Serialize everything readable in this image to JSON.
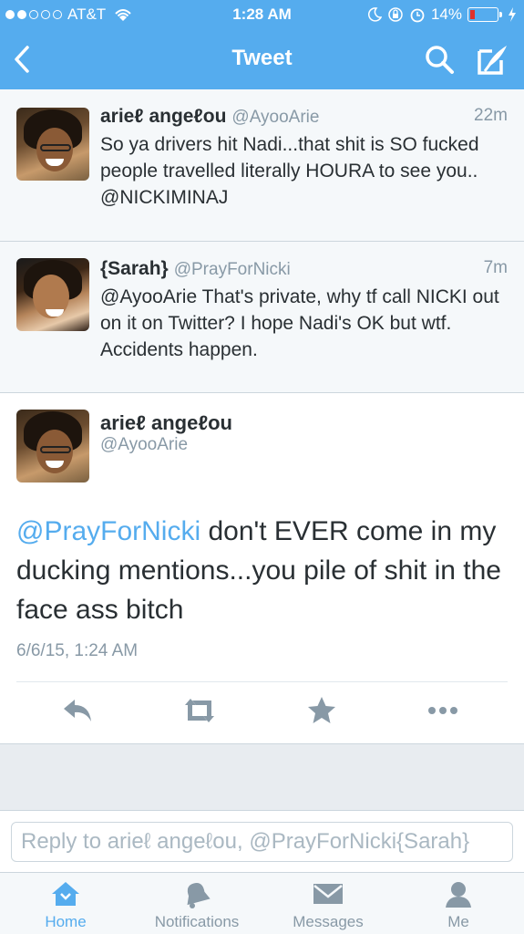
{
  "status_bar": {
    "carrier": "AT&T",
    "time": "1:28 AM",
    "battery": "14%",
    "battery_level": 0.14
  },
  "nav": {
    "title": "Tweet"
  },
  "tweets": [
    {
      "name": "arieℓ angeℓou",
      "handle": "@AyooArie",
      "time": "22m",
      "text": "So ya drivers hit Nadi...that shit is SO fucked people travelled literally HOURA to see you.. @NICKIMINAJ"
    },
    {
      "name": "{Sarah}",
      "handle": "@PrayForNicki",
      "time": "7m",
      "text": "@AyooArie That's private, why tf call NICKI out on it on Twitter? I hope Nadi's OK but wtf. Accidents happen."
    }
  ],
  "main_tweet": {
    "name": "arieℓ angeℓou",
    "handle": "@AyooArie",
    "mention": "@PrayForNicki",
    "text": " don't EVER come in my ducking mentions...you pile of shit in the face ass bitch",
    "date": "6/6/15, 1:24 AM"
  },
  "actions": {
    "icons": [
      "reply-icon",
      "retweet-icon",
      "favorite-icon",
      "more-icon"
    ]
  },
  "reply": {
    "placeholder": "Reply to arieℓ angeℓou, @PrayForNicki{Sarah}"
  },
  "tabbar": {
    "tabs": [
      {
        "label": "Home",
        "icon": "home-icon"
      },
      {
        "label": "Notifications",
        "icon": "bell-icon"
      },
      {
        "label": "Messages",
        "icon": "envelope-icon"
      },
      {
        "label": "Me",
        "icon": "person-icon"
      }
    ]
  },
  "colors": {
    "brand": "#55acee",
    "gray": "#8899a6",
    "text": "#292f33"
  }
}
